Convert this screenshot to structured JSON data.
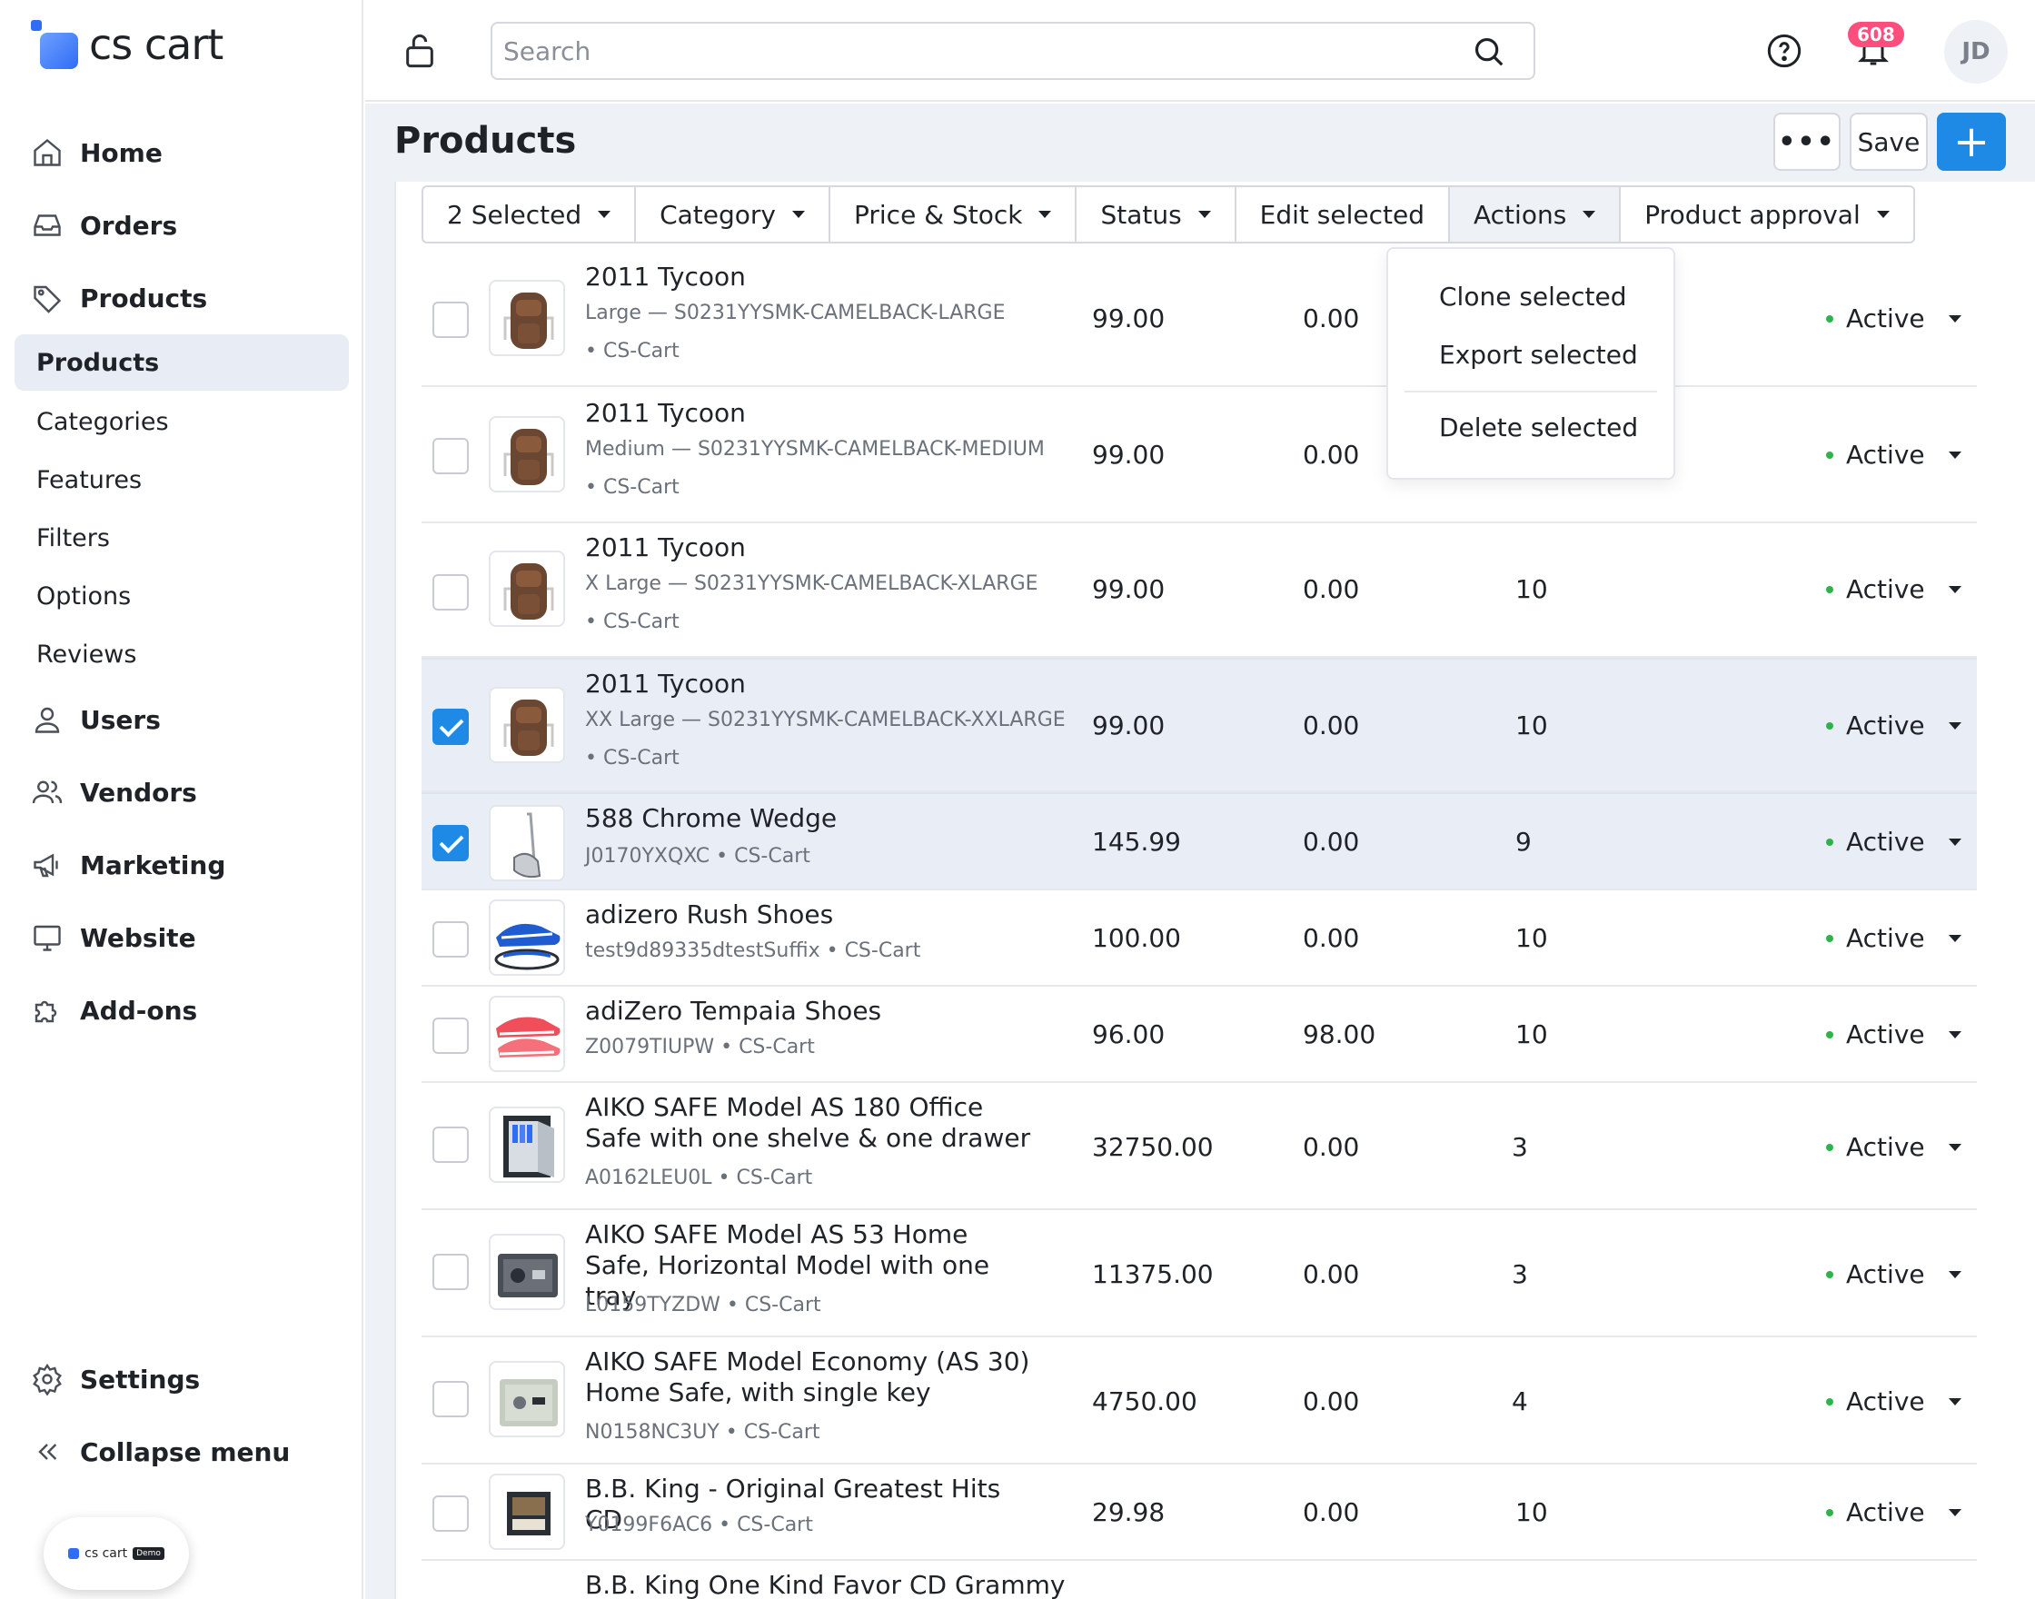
{
  "brand": {
    "name": "cs cart"
  },
  "sidebar": {
    "main": [
      {
        "label": "Home",
        "icon": "home-icon"
      },
      {
        "label": "Orders",
        "icon": "inbox-icon"
      },
      {
        "label": "Products",
        "icon": "tag-icon"
      }
    ],
    "sub": [
      {
        "label": "Products",
        "active": true
      },
      {
        "label": "Categories"
      },
      {
        "label": "Features"
      },
      {
        "label": "Filters"
      },
      {
        "label": "Options"
      },
      {
        "label": "Reviews"
      }
    ],
    "main2": [
      {
        "label": "Users",
        "icon": "user-icon"
      },
      {
        "label": "Vendors",
        "icon": "users-icon"
      },
      {
        "label": "Marketing",
        "icon": "megaphone-icon"
      },
      {
        "label": "Website",
        "icon": "monitor-icon"
      },
      {
        "label": "Add-ons",
        "icon": "puzzle-icon"
      }
    ],
    "settings": "Settings",
    "collapse": "Collapse menu",
    "demo": {
      "logo_text": "cs cart",
      "tag": "Demo"
    }
  },
  "topbar": {
    "search_placeholder": "Search",
    "notifications_count": "608",
    "avatar_initials": "JD"
  },
  "page": {
    "title": "Products",
    "more_label": "•••",
    "save_label": "Save",
    "add_label": "+"
  },
  "toolbar": {
    "selected": "2 Selected",
    "category": "Category",
    "price_stock": "Price & Stock",
    "status": "Status",
    "edit_selected": "Edit selected",
    "actions": "Actions",
    "product_approval": "Product approval"
  },
  "actions_menu": {
    "clone": "Clone selected",
    "export": "Export selected",
    "delete": "Delete selected"
  },
  "products": [
    {
      "name": "2011 Tycoon",
      "meta1": "Large — S0231YYSMK-CAMELBACK-LARGE",
      "meta2": "• CS-Cart",
      "price": "99.00",
      "list_price": "0.00",
      "qty": "",
      "status": "Active",
      "checked": false
    },
    {
      "name": "2011 Tycoon",
      "meta1": "Medium — S0231YYSMK-CAMELBACK-MEDIUM",
      "meta2": "• CS-Cart",
      "price": "99.00",
      "list_price": "0.00",
      "qty": "",
      "status": "Active",
      "checked": false
    },
    {
      "name": "2011 Tycoon",
      "meta1": "X Large — S0231YYSMK-CAMELBACK-XLARGE",
      "meta2": "• CS-Cart",
      "price": "99.00",
      "list_price": "0.00",
      "qty": "10",
      "status": "Active",
      "checked": false
    },
    {
      "name": "2011 Tycoon",
      "meta1": "XX Large — S0231YYSMK-CAMELBACK-XXLARGE",
      "meta2": "• CS-Cart",
      "price": "99.00",
      "list_price": "0.00",
      "qty": "10",
      "status": "Active",
      "checked": true
    },
    {
      "name": "588 Chrome Wedge",
      "meta1": "J0170YXQXC • CS-Cart",
      "price": "145.99",
      "list_price": "0.00",
      "qty": "9",
      "status": "Active",
      "checked": true
    },
    {
      "name": "adizero Rush Shoes",
      "meta1": "test9d89335dtestSuffix • CS-Cart",
      "price": "100.00",
      "list_price": "0.00",
      "qty": "10",
      "status": "Active",
      "checked": false
    },
    {
      "name": "adiZero Tempaia Shoes",
      "meta1": "Z0079TIUPW • CS-Cart",
      "price": "96.00",
      "list_price": "98.00",
      "qty": "10",
      "status": "Active",
      "checked": false
    },
    {
      "name": "AIKO SAFE Model AS 180 Office Safe with one shelve & one drawer",
      "meta1": "A0162LEU0L • CS-Cart",
      "price": "32750.00",
      "list_price": "0.00",
      "qty": "3",
      "status": "Active",
      "checked": false
    },
    {
      "name": "AIKO SAFE Model AS 53 Home Safe, Horizontal Model with one tray",
      "meta1": "L0159TYZDW • CS-Cart",
      "price": "11375.00",
      "list_price": "0.00",
      "qty": "3",
      "status": "Active",
      "checked": false
    },
    {
      "name": "AIKO SAFE Model Economy (AS 30) Home Safe, with single key",
      "meta1": "N0158NC3UY • CS-Cart",
      "price": "4750.00",
      "list_price": "0.00",
      "qty": "4",
      "status": "Active",
      "checked": false
    },
    {
      "name": "B.B. King - Original Greatest Hits CD",
      "meta1": "Y0199F6AC6 • CS-Cart",
      "price": "29.98",
      "list_price": "0.00",
      "qty": "10",
      "status": "Active",
      "checked": false
    },
    {
      "name": "B.B. King One Kind Favor CD Grammy"
    }
  ]
}
